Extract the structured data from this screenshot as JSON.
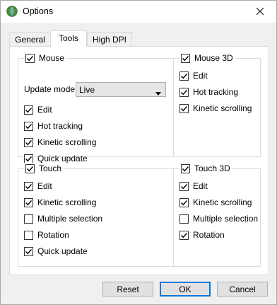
{
  "window": {
    "title": "Options"
  },
  "tabs": [
    {
      "label": "General",
      "active": false
    },
    {
      "label": "Tools",
      "active": true
    },
    {
      "label": "High DPI",
      "active": false
    }
  ],
  "mouse": {
    "title": "Mouse",
    "checked": true,
    "update_mode_label": "Update mode:",
    "update_mode_value": "Live",
    "items": [
      {
        "label": "Edit",
        "checked": true
      },
      {
        "label": "Hot tracking",
        "checked": true
      },
      {
        "label": "Kinetic scrolling",
        "checked": true
      },
      {
        "label": "Quick update",
        "checked": true
      }
    ]
  },
  "mouse3d": {
    "title": "Mouse 3D",
    "checked": true,
    "items": [
      {
        "label": "Edit",
        "checked": true
      },
      {
        "label": "Hot tracking",
        "checked": true
      },
      {
        "label": "Kinetic scrolling",
        "checked": true
      }
    ]
  },
  "touch": {
    "title": "Touch",
    "checked": true,
    "items": [
      {
        "label": "Edit",
        "checked": true
      },
      {
        "label": "Kinetic scrolling",
        "checked": true
      },
      {
        "label": "Multiple selection",
        "checked": false
      },
      {
        "label": "Rotation",
        "checked": false
      },
      {
        "label": "Quick update",
        "checked": true
      }
    ]
  },
  "touch3d": {
    "title": "Touch 3D",
    "checked": true,
    "items": [
      {
        "label": "Edit",
        "checked": true
      },
      {
        "label": "Kinetic scrolling",
        "checked": true
      },
      {
        "label": "Multiple selection",
        "checked": false
      },
      {
        "label": "Rotation",
        "checked": true
      }
    ]
  },
  "buttons": {
    "reset": "Reset",
    "ok": "OK",
    "cancel": "Cancel"
  },
  "colors": {
    "accent": "#0078d7",
    "panel": "#ffffff",
    "background": "#f0f0f0"
  }
}
